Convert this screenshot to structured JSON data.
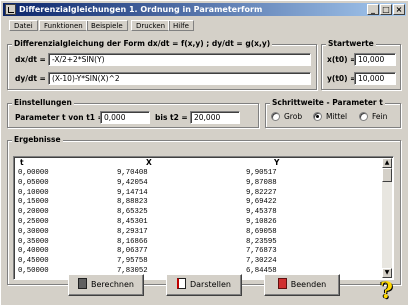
{
  "window": {
    "title": "Differenzialgleichungen 1. Ordnung in Parameterform"
  },
  "menu": [
    "Datei",
    "Funktionen",
    "Beispiele",
    "Drucken",
    "Hilfe"
  ],
  "equations": {
    "group_title": "Differenzialgleichung der Form dx/dt = f(x,y) ; dy/dt = g(x,y)",
    "dx_label": "dx/dt =",
    "dx_value": "-X/2+2*SIN(Y)",
    "dy_label": "dy/dt =",
    "dy_value": "(X-10)-Y*SIN(X)^2"
  },
  "startwerte": {
    "group_title": "Startwerte",
    "x_label": "x(t0) =",
    "x_value": "10,000",
    "y_label": "y(t0) =",
    "y_value": "10,000"
  },
  "einstellungen": {
    "group_title": "Einstellungen",
    "t1_label": "Parameter t von t1 =",
    "t1_value": "0,000",
    "t2_label": "bis t2 =",
    "t2_value": "20,000"
  },
  "schrittweite": {
    "group_title": "Schrittweite - Parameter t",
    "options": [
      "Grob",
      "Mittel",
      "Fein"
    ],
    "selected": "Mittel"
  },
  "ergebnisse": {
    "group_title": "Ergebnisse",
    "columns": [
      "t",
      "X",
      "Y"
    ],
    "rows": [
      [
        "0,00000",
        "9,70408",
        "9,90517"
      ],
      [
        "0,05000",
        "9,42054",
        "9,87088"
      ],
      [
        "0,10000",
        "9,14714",
        "9,82227"
      ],
      [
        "0,15000",
        "8,88823",
        "9,69422"
      ],
      [
        "0,20000",
        "8,65325",
        "9,45378"
      ],
      [
        "0,25000",
        "8,45301",
        "9,10826"
      ],
      [
        "0,30000",
        "8,29317",
        "8,69058"
      ],
      [
        "0,35000",
        "8,16866",
        "8,23595"
      ],
      [
        "0,40000",
        "8,06377",
        "7,76873"
      ],
      [
        "0,45000",
        "7,95758",
        "7,30224"
      ],
      [
        "0,50000",
        "7,83052",
        "6,84458"
      ]
    ]
  },
  "buttons": {
    "berechnen": "Berechnen",
    "darstellen": "Darstellen",
    "beenden": "Beenden"
  },
  "help_symbol": "?"
}
